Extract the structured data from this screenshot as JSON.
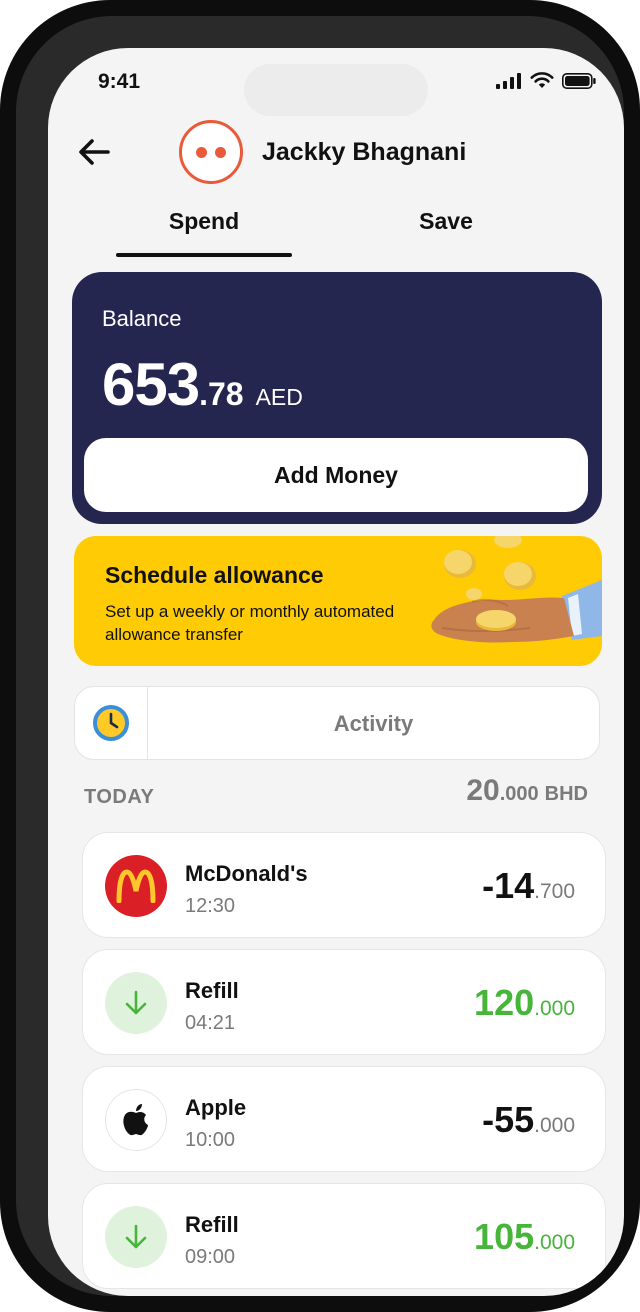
{
  "status": {
    "time": "9:41"
  },
  "header": {
    "name": "Jackky Bhagnani"
  },
  "tabs": [
    {
      "label": "Spend"
    },
    {
      "label": "Save"
    }
  ],
  "balance": {
    "label": "Balance",
    "integer": "653",
    "decimal": ".78",
    "currency": "AED",
    "add_money_label": "Add Money"
  },
  "banner": {
    "title": "Schedule allowance",
    "text": "Set up a weekly or monthly automated allowance transfer"
  },
  "activity": {
    "label": "Activity"
  },
  "today": {
    "label": "TODAY",
    "total_integer": "20",
    "total_decimal": ".000",
    "total_currency": "BHD"
  },
  "transactions": [
    {
      "name": "McDonald's",
      "time": "12:30",
      "integer": "-14",
      "decimal": ".700",
      "icon": "mcdonalds-logo-icon",
      "type": "debit"
    },
    {
      "name": "Refill",
      "time": "04:21",
      "integer": "120",
      "decimal": ".000",
      "icon": "arrow-down-icon",
      "type": "credit"
    },
    {
      "name": "Apple",
      "time": "10:00",
      "integer": "-55",
      "decimal": ".000",
      "icon": "apple-logo-icon",
      "type": "debit"
    },
    {
      "name": "Refill",
      "time": "09:00",
      "integer": "105",
      "decimal": ".000",
      "icon": "arrow-down-icon",
      "type": "credit"
    }
  ],
  "colors": {
    "card": "#25264f",
    "banner": "#ffcb05",
    "positive": "#46b53a",
    "avatar": "#e95a3a"
  }
}
